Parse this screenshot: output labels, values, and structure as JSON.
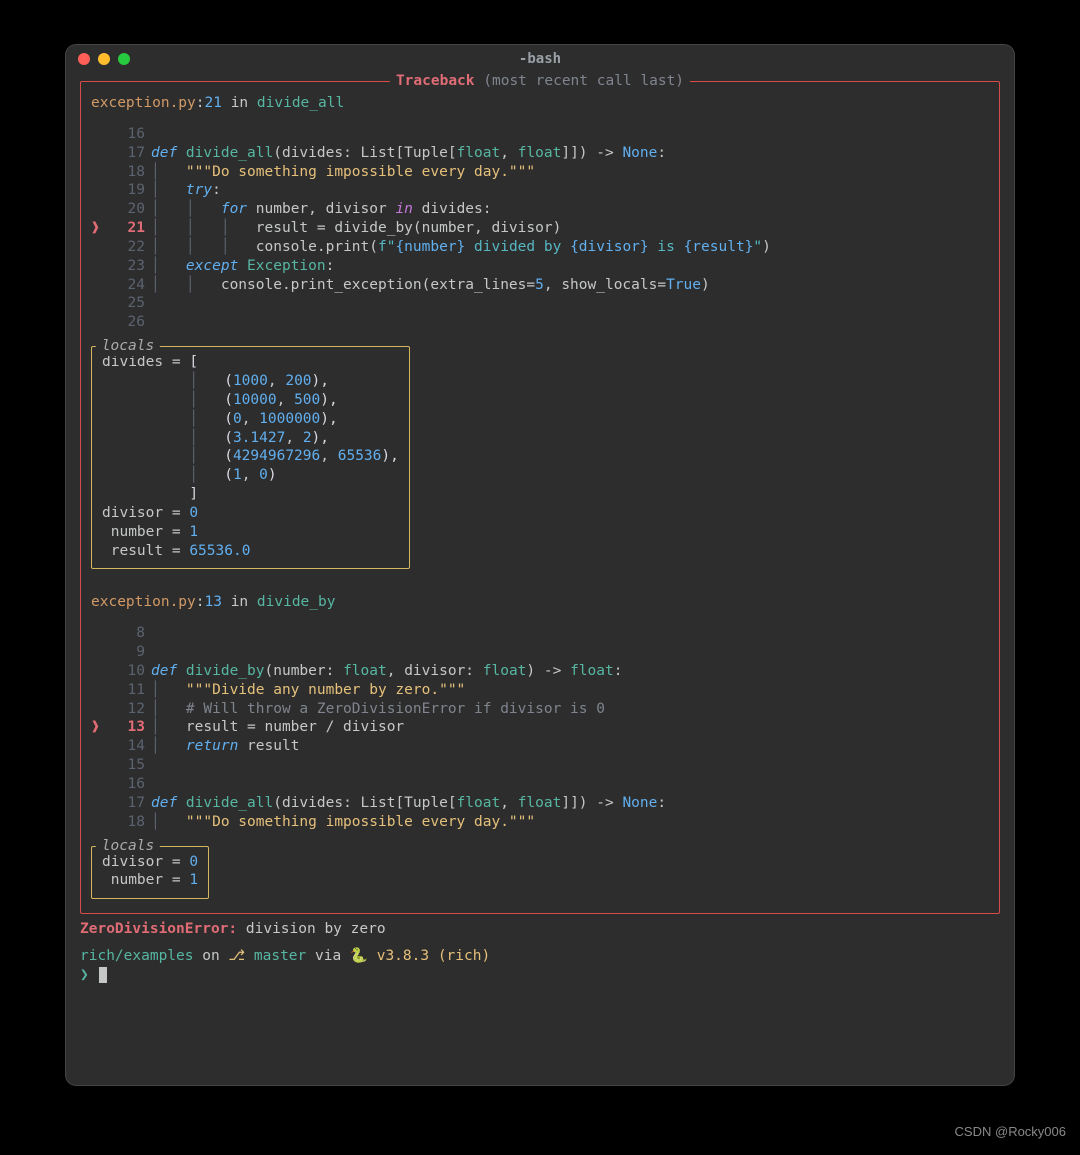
{
  "window": {
    "title": "-bash"
  },
  "traceback": {
    "panel_title_a": "Traceback",
    "panel_title_b": "(most recent call last)",
    "frames": [
      {
        "file": "exception.py",
        "line": "21",
        "in_kw": "in",
        "func": "divide_all",
        "code": [
          {
            "n": "16",
            "hl": false,
            "segs": []
          },
          {
            "n": "17",
            "hl": false,
            "segs": [
              {
                "t": "def ",
                "c": "c-kw"
              },
              {
                "t": "divide_all",
                "c": "c-fn"
              },
              {
                "t": "(divides: List[Tuple[",
                "c": "c-plain"
              },
              {
                "t": "float",
                "c": "c-teal"
              },
              {
                "t": ", ",
                "c": "c-plain"
              },
              {
                "t": "float",
                "c": "c-teal"
              },
              {
                "t": "]]) -> ",
                "c": "c-plain"
              },
              {
                "t": "None",
                "c": "c-blue"
              },
              {
                "t": ":",
                "c": "c-plain"
              }
            ]
          },
          {
            "n": "18",
            "hl": false,
            "segs": [
              {
                "t": "│   ",
                "c": "c-dim"
              },
              {
                "t": "\"\"\"Do something impossible every day.\"\"\"",
                "c": "c-str"
              }
            ]
          },
          {
            "n": "19",
            "hl": false,
            "segs": [
              {
                "t": "│   ",
                "c": "c-dim"
              },
              {
                "t": "try",
                "c": "c-kw"
              },
              {
                "t": ":",
                "c": "c-plain"
              }
            ]
          },
          {
            "n": "20",
            "hl": false,
            "segs": [
              {
                "t": "│   │   ",
                "c": "c-dim"
              },
              {
                "t": "for",
                "c": "c-kw"
              },
              {
                "t": " number, divisor ",
                "c": "c-plain"
              },
              {
                "t": "in",
                "c": "c-in"
              },
              {
                "t": " divides:",
                "c": "c-plain"
              }
            ]
          },
          {
            "n": "21",
            "hl": true,
            "segs": [
              {
                "t": "│   │   │   ",
                "c": "c-dim"
              },
              {
                "t": "result = divide_by(number, divisor)",
                "c": "c-plain"
              }
            ]
          },
          {
            "n": "22",
            "hl": false,
            "segs": [
              {
                "t": "│   │   │   ",
                "c": "c-dim"
              },
              {
                "t": "console.print(",
                "c": "c-plain"
              },
              {
                "t": "f\"",
                "c": "c-fstr"
              },
              {
                "t": "{number}",
                "c": "c-blue"
              },
              {
                "t": " divided by ",
                "c": "c-fstr"
              },
              {
                "t": "{divisor}",
                "c": "c-blue"
              },
              {
                "t": " is ",
                "c": "c-fstr"
              },
              {
                "t": "{result}",
                "c": "c-blue"
              },
              {
                "t": "\"",
                "c": "c-fstr"
              },
              {
                "t": ")",
                "c": "c-plain"
              }
            ]
          },
          {
            "n": "23",
            "hl": false,
            "segs": [
              {
                "t": "│   ",
                "c": "c-dim"
              },
              {
                "t": "except",
                "c": "c-kw"
              },
              {
                "t": " ",
                "c": "c-plain"
              },
              {
                "t": "Exception",
                "c": "c-teal"
              },
              {
                "t": ":",
                "c": "c-plain"
              }
            ]
          },
          {
            "n": "24",
            "hl": false,
            "segs": [
              {
                "t": "│   │   ",
                "c": "c-dim"
              },
              {
                "t": "console.print_exception(extra_lines=",
                "c": "c-plain"
              },
              {
                "t": "5",
                "c": "c-num"
              },
              {
                "t": ", show_locals=",
                "c": "c-plain"
              },
              {
                "t": "True",
                "c": "c-blue"
              },
              {
                "t": ")",
                "c": "c-plain"
              }
            ]
          },
          {
            "n": "25",
            "hl": false,
            "segs": []
          },
          {
            "n": "26",
            "hl": false,
            "segs": []
          }
        ],
        "locals_title": "locals",
        "locals": [
          [
            {
              "t": "divides = ",
              "c": "c-plain"
            },
            {
              "t": "[",
              "c": "c-white"
            }
          ],
          [
            {
              "t": "          │   ",
              "c": "c-dim"
            },
            {
              "t": "(",
              "c": "c-white"
            },
            {
              "t": "1000",
              "c": "c-num"
            },
            {
              "t": ", ",
              "c": "c-plain"
            },
            {
              "t": "200",
              "c": "c-num"
            },
            {
              "t": "),",
              "c": "c-white"
            }
          ],
          [
            {
              "t": "          │   ",
              "c": "c-dim"
            },
            {
              "t": "(",
              "c": "c-white"
            },
            {
              "t": "10000",
              "c": "c-num"
            },
            {
              "t": ", ",
              "c": "c-plain"
            },
            {
              "t": "500",
              "c": "c-num"
            },
            {
              "t": "),",
              "c": "c-white"
            }
          ],
          [
            {
              "t": "          │   ",
              "c": "c-dim"
            },
            {
              "t": "(",
              "c": "c-white"
            },
            {
              "t": "0",
              "c": "c-num"
            },
            {
              "t": ", ",
              "c": "c-plain"
            },
            {
              "t": "1000000",
              "c": "c-num"
            },
            {
              "t": "),",
              "c": "c-white"
            }
          ],
          [
            {
              "t": "          │   ",
              "c": "c-dim"
            },
            {
              "t": "(",
              "c": "c-white"
            },
            {
              "t": "3.1427",
              "c": "c-num"
            },
            {
              "t": ", ",
              "c": "c-plain"
            },
            {
              "t": "2",
              "c": "c-num"
            },
            {
              "t": "),",
              "c": "c-white"
            }
          ],
          [
            {
              "t": "          │   ",
              "c": "c-dim"
            },
            {
              "t": "(",
              "c": "c-white"
            },
            {
              "t": "4294967296",
              "c": "c-num"
            },
            {
              "t": ", ",
              "c": "c-plain"
            },
            {
              "t": "65536",
              "c": "c-num"
            },
            {
              "t": "),",
              "c": "c-white"
            }
          ],
          [
            {
              "t": "          │   ",
              "c": "c-dim"
            },
            {
              "t": "(",
              "c": "c-white"
            },
            {
              "t": "1",
              "c": "c-num"
            },
            {
              "t": ", ",
              "c": "c-plain"
            },
            {
              "t": "0",
              "c": "c-num"
            },
            {
              "t": ")",
              "c": "c-white"
            }
          ],
          [
            {
              "t": "          ",
              "c": "c-dim"
            },
            {
              "t": "]",
              "c": "c-white"
            }
          ],
          [
            {
              "t": "divisor = ",
              "c": "c-plain"
            },
            {
              "t": "0",
              "c": "c-num"
            }
          ],
          [
            {
              "t": " number = ",
              "c": "c-plain"
            },
            {
              "t": "1",
              "c": "c-num"
            }
          ],
          [
            {
              "t": " result = ",
              "c": "c-plain"
            },
            {
              "t": "65536.0",
              "c": "c-num"
            }
          ]
        ]
      },
      {
        "file": "exception.py",
        "line": "13",
        "in_kw": "in",
        "func": "divide_by",
        "code": [
          {
            "n": "8",
            "hl": false,
            "segs": []
          },
          {
            "n": "9",
            "hl": false,
            "segs": []
          },
          {
            "n": "10",
            "hl": false,
            "segs": [
              {
                "t": "def ",
                "c": "c-kw"
              },
              {
                "t": "divide_by",
                "c": "c-fn"
              },
              {
                "t": "(number: ",
                "c": "c-plain"
              },
              {
                "t": "float",
                "c": "c-teal"
              },
              {
                "t": ", divisor: ",
                "c": "c-plain"
              },
              {
                "t": "float",
                "c": "c-teal"
              },
              {
                "t": ") -> ",
                "c": "c-plain"
              },
              {
                "t": "float",
                "c": "c-teal"
              },
              {
                "t": ":",
                "c": "c-plain"
              }
            ]
          },
          {
            "n": "11",
            "hl": false,
            "segs": [
              {
                "t": "│   ",
                "c": "c-dim"
              },
              {
                "t": "\"\"\"Divide any number by zero.\"\"\"",
                "c": "c-str"
              }
            ]
          },
          {
            "n": "12",
            "hl": false,
            "segs": [
              {
                "t": "│   ",
                "c": "c-dim"
              },
              {
                "t": "# Will throw a ZeroDivisionError if divisor is 0",
                "c": "c-gray"
              }
            ]
          },
          {
            "n": "13",
            "hl": true,
            "segs": [
              {
                "t": "│   ",
                "c": "c-dim"
              },
              {
                "t": "result = number / divisor",
                "c": "c-plain"
              }
            ]
          },
          {
            "n": "14",
            "hl": false,
            "segs": [
              {
                "t": "│   ",
                "c": "c-dim"
              },
              {
                "t": "return",
                "c": "c-kw"
              },
              {
                "t": " result",
                "c": "c-plain"
              }
            ]
          },
          {
            "n": "15",
            "hl": false,
            "segs": []
          },
          {
            "n": "16",
            "hl": false,
            "segs": []
          },
          {
            "n": "17",
            "hl": false,
            "segs": [
              {
                "t": "def ",
                "c": "c-kw"
              },
              {
                "t": "divide_all",
                "c": "c-fn"
              },
              {
                "t": "(divides: List[Tuple[",
                "c": "c-plain"
              },
              {
                "t": "float",
                "c": "c-teal"
              },
              {
                "t": ", ",
                "c": "c-plain"
              },
              {
                "t": "float",
                "c": "c-teal"
              },
              {
                "t": "]]) -> ",
                "c": "c-plain"
              },
              {
                "t": "None",
                "c": "c-blue"
              },
              {
                "t": ":",
                "c": "c-plain"
              }
            ]
          },
          {
            "n": "18",
            "hl": false,
            "segs": [
              {
                "t": "│   ",
                "c": "c-dim"
              },
              {
                "t": "\"\"\"Do something impossible every day.\"\"\"",
                "c": "c-str"
              }
            ]
          }
        ],
        "locals_title": "locals",
        "locals": [
          [
            {
              "t": "divisor = ",
              "c": "c-plain"
            },
            {
              "t": "0",
              "c": "c-num"
            }
          ],
          [
            {
              "t": " number = ",
              "c": "c-plain"
            },
            {
              "t": "1",
              "c": "c-num"
            }
          ]
        ]
      }
    ]
  },
  "error": {
    "type": "ZeroDivisionError:",
    "message": "division by zero"
  },
  "prompt": {
    "segs": [
      {
        "t": "rich/examples",
        "c": "c-teal"
      },
      {
        "t": " on ",
        "c": "c-plain"
      },
      {
        "t": "⎇ ",
        "c": "c-yellow"
      },
      {
        "t": "master",
        "c": "c-teal"
      },
      {
        "t": " via ",
        "c": "c-plain"
      },
      {
        "t": "🐍 ",
        "c": "c-plain"
      },
      {
        "t": "v3.8.3 (rich)",
        "c": "c-yellow"
      }
    ],
    "symbol": "❯"
  },
  "watermark": "CSDN @Rocky006"
}
